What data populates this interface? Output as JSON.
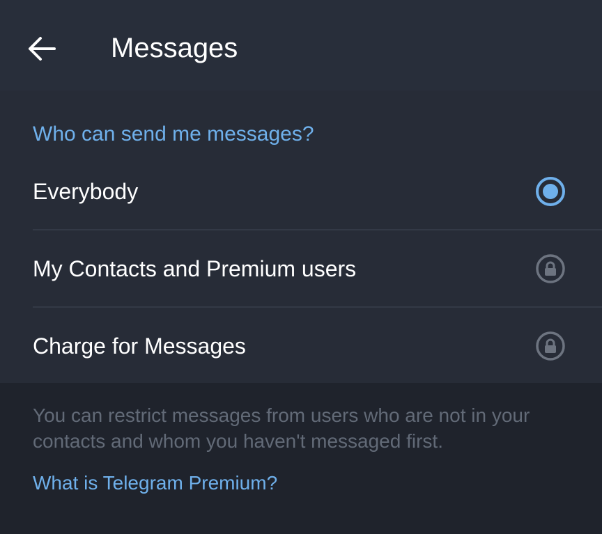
{
  "header": {
    "back_icon": "arrow-left-icon",
    "title": "Messages"
  },
  "section": {
    "header": "Who can send me messages?",
    "options": [
      {
        "label": "Everybody",
        "state": "selected",
        "icon": "radio-selected-icon"
      },
      {
        "label": "My Contacts and Premium users",
        "state": "locked",
        "icon": "lock-icon"
      },
      {
        "label": "Charge for Messages",
        "state": "locked",
        "icon": "lock-icon"
      }
    ]
  },
  "footer": {
    "description": "You can restrict messages from users who are not in your contacts and whom you haven't messaged first.",
    "link": "What is Telegram Premium?"
  },
  "colors": {
    "background": "#1f232c",
    "header_bg": "#282e3a",
    "section_bg": "#272c37",
    "accent": "#6fb0eb",
    "text_primary": "#ffffff",
    "text_secondary": "#626a77"
  }
}
